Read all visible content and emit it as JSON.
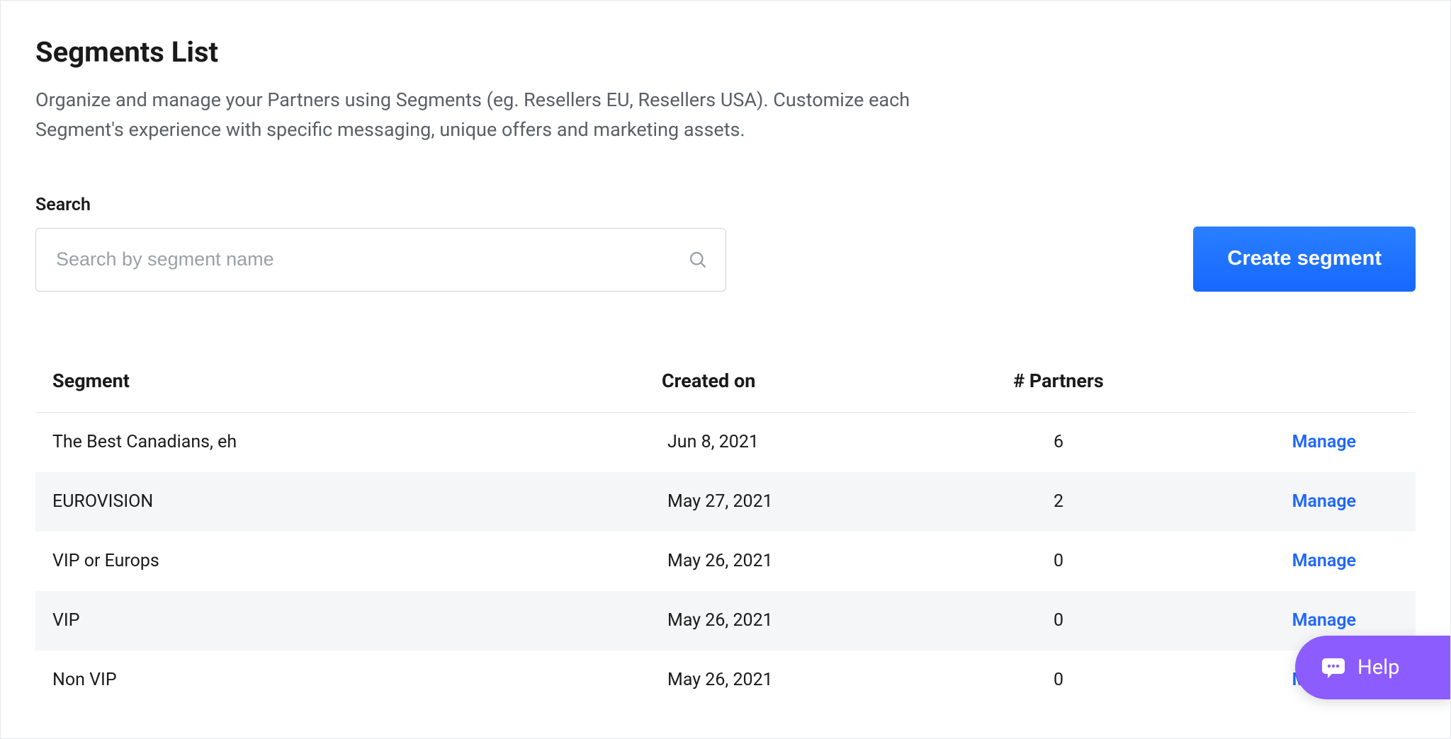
{
  "header": {
    "title": "Segments List",
    "description": "Organize and manage your Partners using Segments (eg. Resellers EU, Resellers USA). Customize each Segment's experience with specific messaging, unique offers and marketing assets."
  },
  "search": {
    "label": "Search",
    "placeholder": "Search by segment name",
    "value": ""
  },
  "actions": {
    "create_label": "Create segment"
  },
  "table": {
    "columns": {
      "segment": "Segment",
      "created": "Created on",
      "partners": "# Partners"
    },
    "action_label": "Manage",
    "rows": [
      {
        "name": "The Best Canadians, eh",
        "created_on": "Jun 8, 2021",
        "partners": "6"
      },
      {
        "name": "EUROVISION",
        "created_on": "May 27, 2021",
        "partners": "2"
      },
      {
        "name": "VIP or Europs",
        "created_on": "May 26, 2021",
        "partners": "0"
      },
      {
        "name": "VIP",
        "created_on": "May 26, 2021",
        "partners": "0"
      },
      {
        "name": "Non VIP",
        "created_on": "May 26, 2021",
        "partners": "0"
      }
    ]
  },
  "help": {
    "label": "Help"
  },
  "colors": {
    "accent": "#1668ff",
    "link": "#1f66ff",
    "help_bg": "#8c5cff"
  }
}
